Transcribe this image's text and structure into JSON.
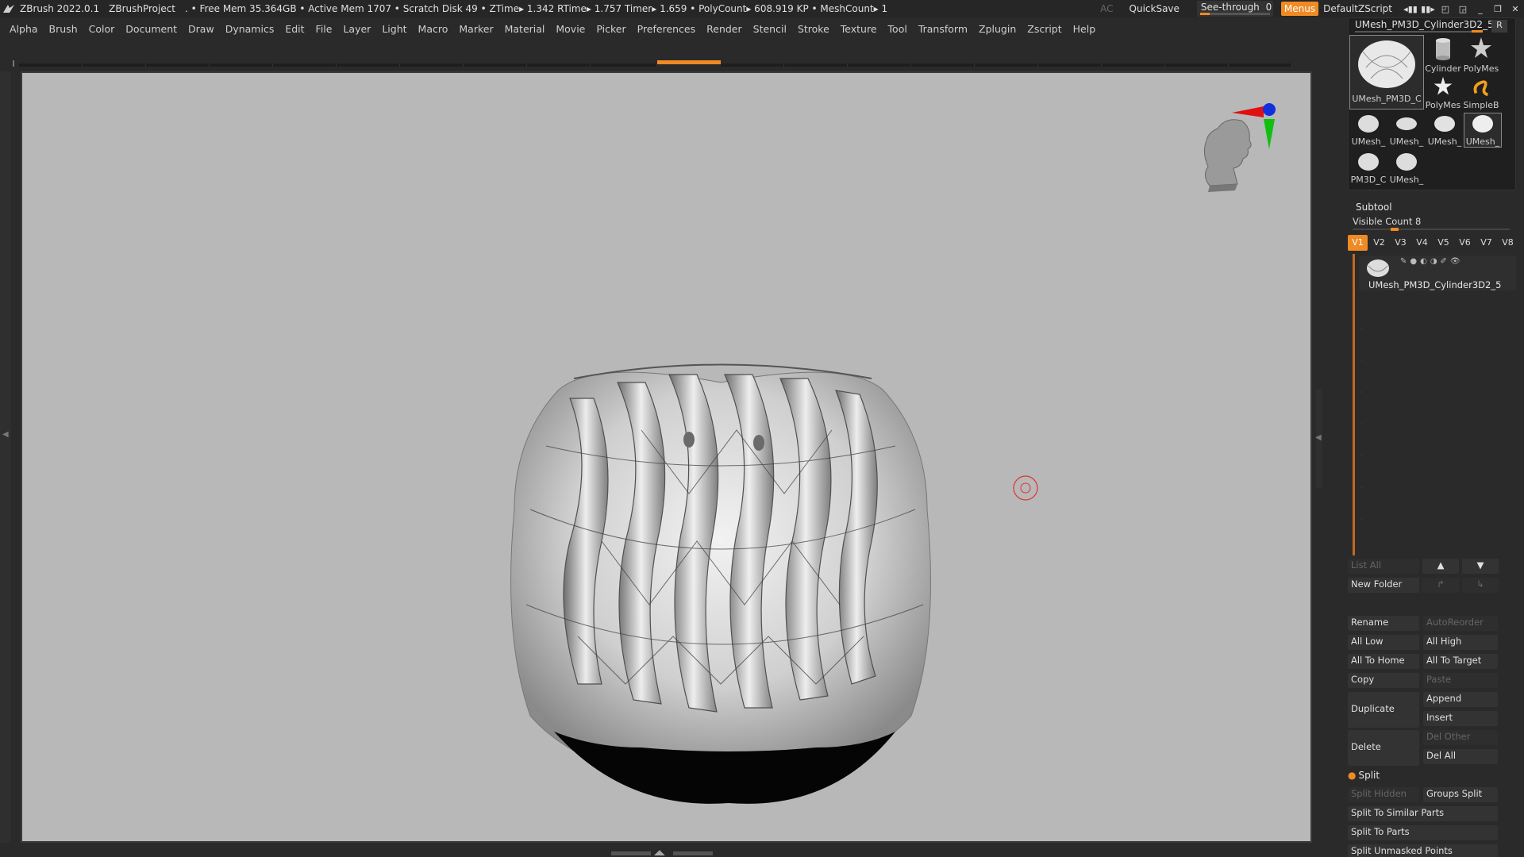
{
  "titlebar": {
    "app": "ZBrush 2022.0.1",
    "project": "ZBrushProject",
    "stats": ". • Free Mem 35.364GB • Active Mem 1707 • Scratch Disk 49 •  ZTime▸ 1.342 RTime▸ 1.757 Timer▸ 1.659 • PolyCount▸ 608.919 KP  • MeshCount▸ 1",
    "ac": "AC",
    "quicksave": "QuickSave",
    "seethrough_label": "See-through",
    "seethrough_value": "0",
    "menus": "Menus",
    "default_zscript": "DefaultZScript"
  },
  "menubar": {
    "items": [
      "Alpha",
      "Brush",
      "Color",
      "Document",
      "Draw",
      "Dynamics",
      "Edit",
      "File",
      "Layer",
      "Light",
      "Macro",
      "Marker",
      "Material",
      "Movie",
      "Picker",
      "Preferences",
      "Render",
      "Stencil",
      "Stroke",
      "Texture",
      "Tool",
      "Transform",
      "Zplugin",
      "Zscript",
      "Help"
    ]
  },
  "tool": {
    "current_name": "UMesh_PM3D_Cylinder3D2_5",
    "r_button": "R",
    "thumbs": [
      {
        "label": "UMesh_PM3D_C"
      },
      {
        "label": "Cylinder"
      },
      {
        "label": "PolyMes"
      },
      {
        "label": "PolyMes"
      },
      {
        "label": "SimpleB"
      },
      {
        "label": "UMesh_"
      },
      {
        "label": "UMesh_"
      },
      {
        "label": "UMesh_"
      },
      {
        "label": "UMesh_"
      },
      {
        "label": "PM3D_C"
      },
      {
        "label": "UMesh_"
      }
    ]
  },
  "subtool": {
    "title": "Subtool",
    "visible_count_label": "Visible Count",
    "visible_count_value": "8",
    "tabs": [
      "V1",
      "V2",
      "V3",
      "V4",
      "V5",
      "V6",
      "V7",
      "V8"
    ],
    "active_tab": "V1",
    "items": [
      {
        "name": "UMesh_PM3D_Cylinder3D2_5"
      }
    ],
    "buttons": {
      "list_all": "List All",
      "new_folder": "New Folder",
      "rename": "Rename",
      "auto_reorder": "AutoReorder",
      "all_low": "All Low",
      "all_high": "All High",
      "all_to_home": "All To Home",
      "all_to_target": "All To Target",
      "copy": "Copy",
      "paste": "Paste",
      "duplicate": "Duplicate",
      "append": "Append",
      "insert": "Insert",
      "delete": "Delete",
      "del_other": "Del Other",
      "del_all": "Del All"
    }
  },
  "split": {
    "title": "Split",
    "split_hidden": "Split Hidden",
    "groups_split": "Groups Split",
    "split_to_similar_parts": "Split To Similar Parts",
    "split_to_parts": "Split To Parts",
    "split_unmasked_points": "Split Unmasked Points"
  },
  "colors": {
    "accent": "#f08a24",
    "canvas": "#b8b8b8",
    "panel": "#2a2a2a"
  }
}
